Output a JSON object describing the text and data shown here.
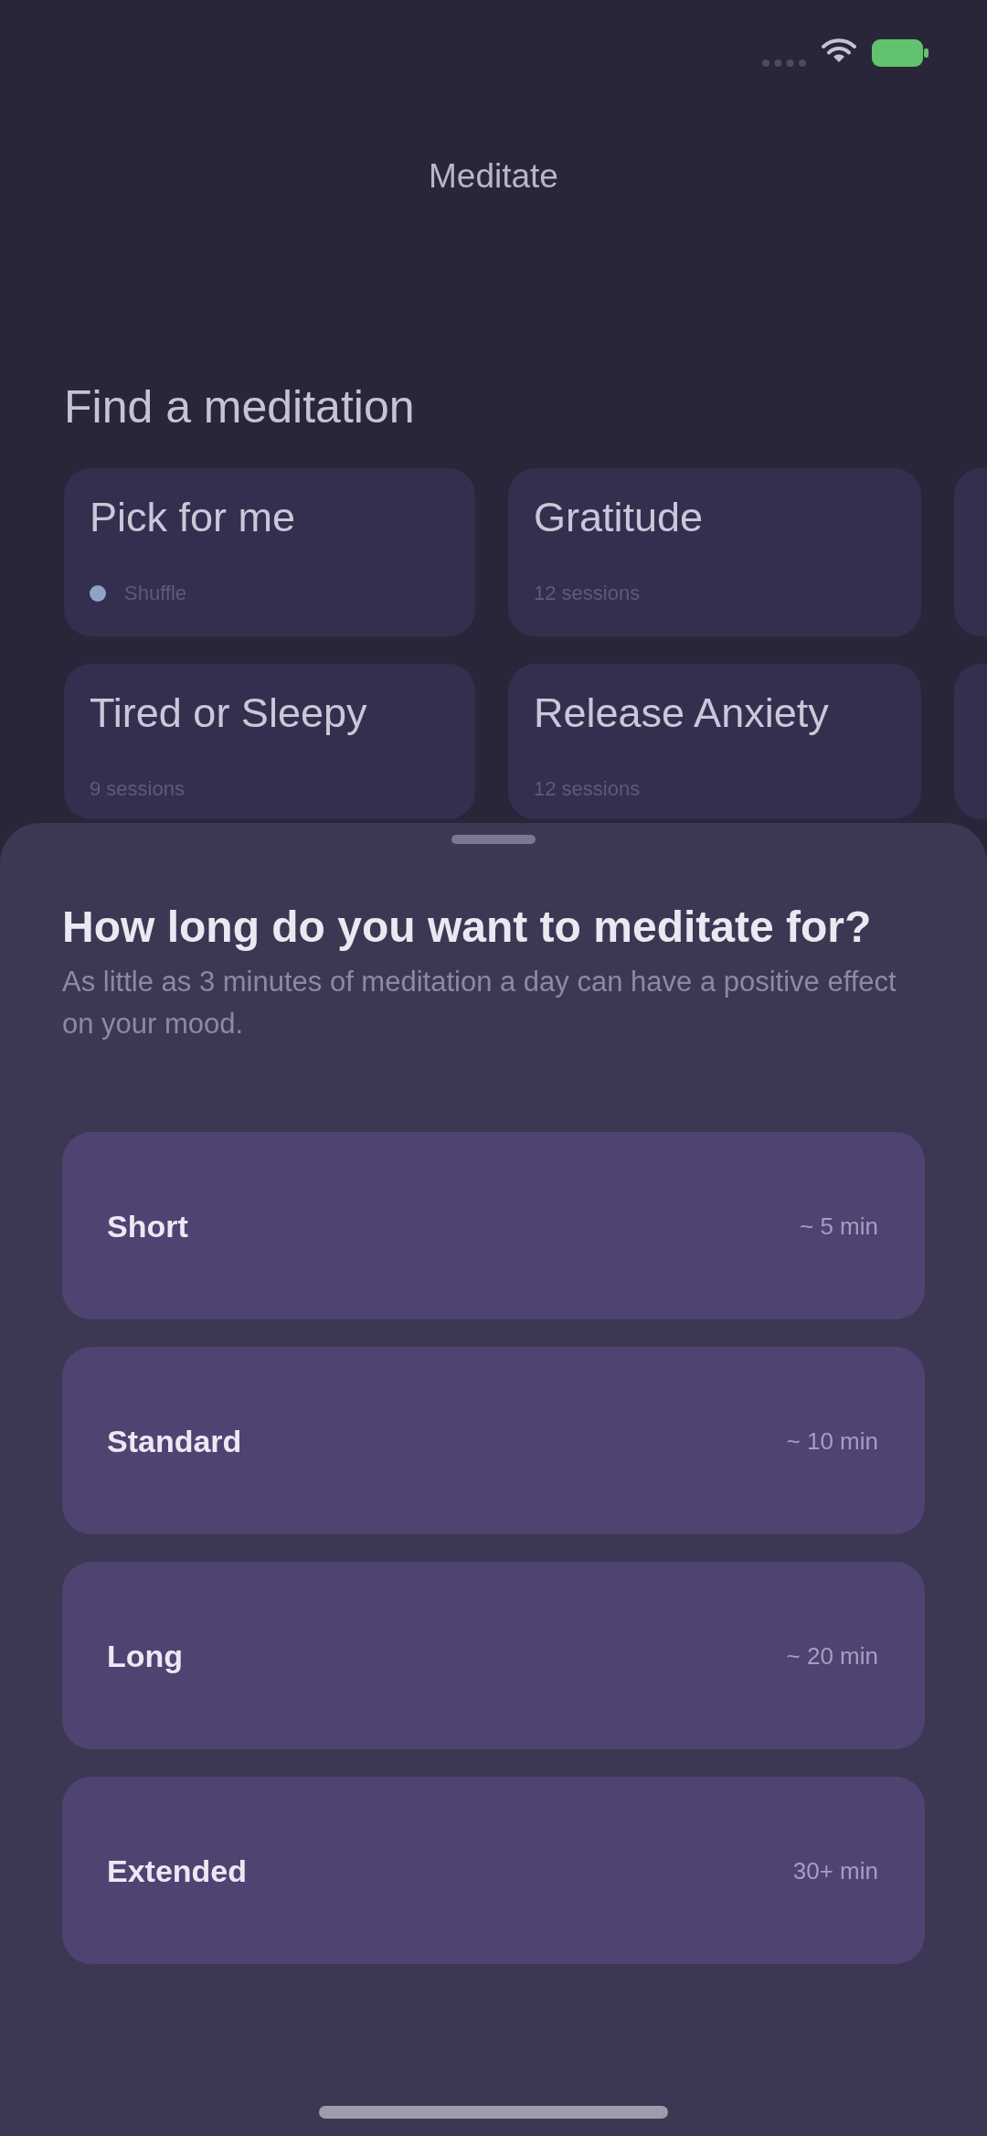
{
  "header": {
    "title": "Meditate"
  },
  "find": {
    "title": "Find a meditation",
    "cards": [
      {
        "kind": "pick",
        "title": "Pick for me",
        "subtitle": "Shuffle"
      },
      {
        "kind": "topic",
        "title": "Gratitude",
        "subtitle": "12 sessions"
      },
      {
        "kind": "clipped"
      },
      {
        "kind": "topic",
        "title": "Tired or Sleepy",
        "subtitle": "9 sessions"
      },
      {
        "kind": "topic",
        "title": "Release Anxiety",
        "subtitle": "12 sessions"
      },
      {
        "kind": "clipped"
      }
    ]
  },
  "sheet": {
    "heading": "How long do you want to meditate for?",
    "description": "As little as 3 minutes of meditation a day can have a positive effect on your mood.",
    "options": [
      {
        "label": "Short",
        "duration": "~ 5 min"
      },
      {
        "label": "Standard",
        "duration": "~ 10 min"
      },
      {
        "label": "Long",
        "duration": "~ 20 min"
      },
      {
        "label": "Extended",
        "duration": "30+ min"
      }
    ]
  }
}
